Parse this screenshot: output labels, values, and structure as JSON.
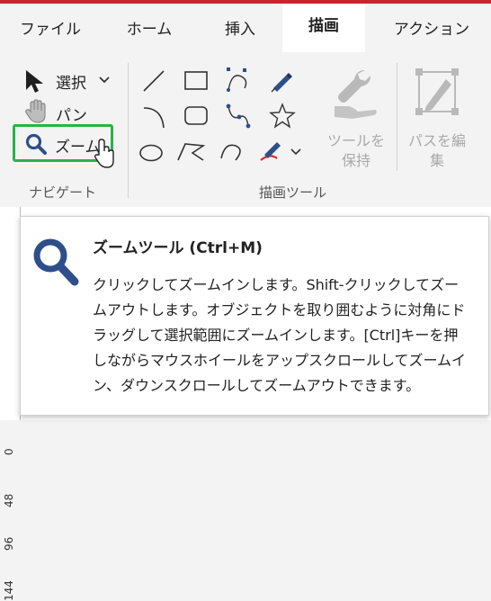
{
  "tabs": [
    {
      "label": "ファイル"
    },
    {
      "label": "ホーム"
    },
    {
      "label": "挿入"
    },
    {
      "label": "描画"
    },
    {
      "label": "アクション"
    }
  ],
  "navigate": {
    "select_label": "選択",
    "pan_label": "パン",
    "zoom_label": "ズーム",
    "group_label": "ナビゲート"
  },
  "draw": {
    "group_label": "描画ツール",
    "tool_settings_label": "ツールを保持",
    "path_edit_label": "パスを編集"
  },
  "ruler": {
    "ticks": [
      "0",
      "48",
      "96",
      "144"
    ]
  },
  "tooltip": {
    "title": "ズームツール (Ctrl+M)",
    "body": "クリックしてズームインします。Shift-クリックしてズームアウトします。オブジェクトを取り囲むように対角にドラッグして選択範囲にズームインします。[Ctrl]キーを押しながらマウスホイールをアップスクロールしてズームイン、ダウンスクロールしてズームアウトできます。"
  },
  "colors": {
    "accent_red": "#c4262e",
    "zoom_icon_blue": "#2d4f8a",
    "highlight_green": "#29b34a"
  }
}
